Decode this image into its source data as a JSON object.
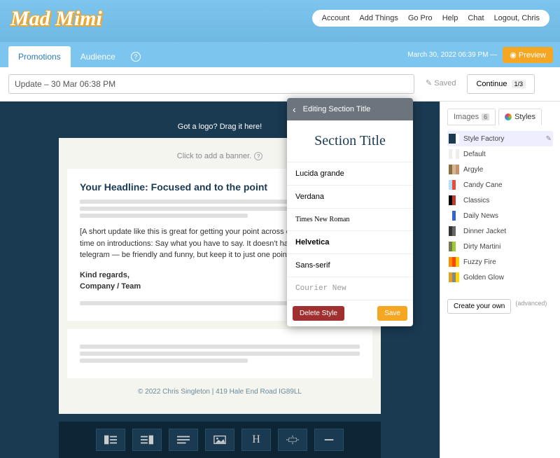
{
  "brand": "Mad Mimi",
  "top_nav": [
    "Account",
    "Add Things",
    "Go Pro",
    "Help",
    "Chat",
    "Logout, Chris"
  ],
  "tabs": {
    "promotions": "Promotions",
    "audience": "Audience"
  },
  "status_date": "March 30, 2022 06:39 PM —",
  "preview_btn": "◉ Preview",
  "title_input": "Update – 30 Mar 06:38 PM",
  "saved_label": "Saved",
  "continue_btn": "Continue",
  "continue_step": "1/3",
  "canvas": {
    "logo_drop": "Got a logo? Drag it here!",
    "banner_prompt": "Click to add a banner.",
    "headline": "Your Headline: Focused and to the point",
    "body": "[A short update like this is great for getting your point across quickly. Don't waste time on introductions: Say what you have to say. It doesn't have to be cold, like a telegram — be friendly and funny, but keep it to just one point if you can.]",
    "sign1": "Kind regards,",
    "sign2": "Company / Team",
    "footer": "© 2022 Chris Singleton | 419 Hale End Road IG89LL"
  },
  "popup": {
    "header": "Editing  Section Title",
    "preview": "Section Title",
    "fonts": [
      "Lucida grande",
      "Verdana",
      "Times New Roman",
      "Helvetica",
      "Sans-serif",
      "Courier New"
    ],
    "delete": "Delete Style",
    "save": "Save"
  },
  "side": {
    "tab_images": "Images",
    "images_count": "6",
    "tab_styles": "Styles",
    "styles": [
      {
        "name": "Style Factory",
        "c": [
          "#1a3a52",
          "#1a3a52",
          "#fff"
        ],
        "sel": true
      },
      {
        "name": "Default",
        "c": [
          "#eee",
          "#fff",
          "#eee"
        ]
      },
      {
        "name": "Argyle",
        "c": [
          "#8b6f3e",
          "#d4b896",
          "#c4936b"
        ]
      },
      {
        "name": "Candy Cane",
        "c": [
          "#b3e0ff",
          "#e74c3c",
          "#fff"
        ]
      },
      {
        "name": "Classics",
        "c": [
          "#000",
          "#c0392b",
          "#fff"
        ]
      },
      {
        "name": "Daily News",
        "c": [
          "#fff",
          "#3366cc",
          "#fff"
        ]
      },
      {
        "name": "Dinner Jacket",
        "c": [
          "#333",
          "#666",
          "#fff"
        ]
      },
      {
        "name": "Dirty Martini",
        "c": [
          "#7a7a52",
          "#9acd32",
          "#fff"
        ]
      },
      {
        "name": "Fuzzy Fire",
        "c": [
          "#ff8c00",
          "#ff4500",
          "#ffcc00"
        ]
      },
      {
        "name": "Golden Glow",
        "c": [
          "#daa520",
          "#888",
          "#ffd700"
        ]
      }
    ],
    "create": "Create your own",
    "advanced": "(advanced)"
  }
}
